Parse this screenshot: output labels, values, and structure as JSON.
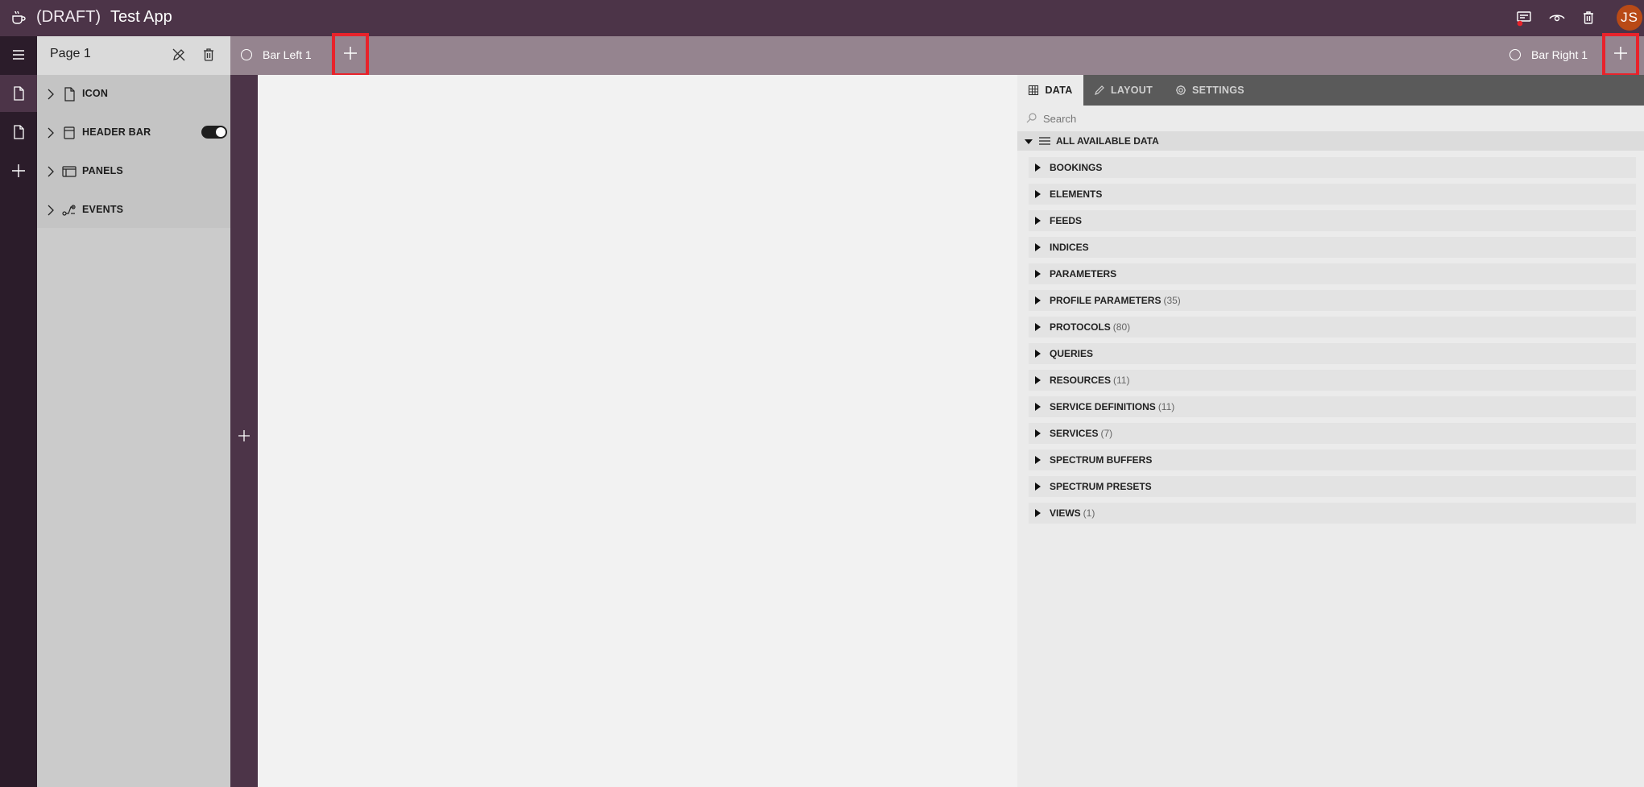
{
  "header": {
    "draft_label": "(DRAFT)",
    "app_title": "Test App",
    "avatar_initials": "JS",
    "icons": [
      "coffee-app-icon",
      "publish-icon",
      "preview-eye-icon",
      "delete-trash-icon"
    ]
  },
  "rail": {
    "icons": [
      "hamburger-menu-icon",
      "page-icon",
      "page-icon",
      "add-icon"
    ]
  },
  "page_tree": {
    "page_name": "Page 1",
    "items": [
      {
        "label": "ICON",
        "icon": "file-icon"
      },
      {
        "label": "HEADER BAR",
        "icon": "header-bar-icon",
        "toggle_on": true
      },
      {
        "label": "PANELS",
        "icon": "panels-icon"
      },
      {
        "label": "EVENTS",
        "icon": "events-icon"
      }
    ]
  },
  "bars": {
    "left_label": "Bar Left 1",
    "right_label": "Bar Right 1"
  },
  "right_panel": {
    "tabs": [
      {
        "label": "DATA",
        "active": true
      },
      {
        "label": "LAYOUT",
        "active": false
      },
      {
        "label": "SETTINGS",
        "active": false
      }
    ],
    "search_placeholder": "Search",
    "root_label": "ALL AVAILABLE DATA",
    "items": [
      {
        "label": "BOOKINGS",
        "count": ""
      },
      {
        "label": "ELEMENTS",
        "count": ""
      },
      {
        "label": "FEEDS",
        "count": ""
      },
      {
        "label": "INDICES",
        "count": ""
      },
      {
        "label": "PARAMETERS",
        "count": ""
      },
      {
        "label": "PROFILE PARAMETERS",
        "count": "(35)"
      },
      {
        "label": "PROTOCOLS",
        "count": "(80)"
      },
      {
        "label": "QUERIES",
        "count": ""
      },
      {
        "label": "RESOURCES",
        "count": "(11)"
      },
      {
        "label": "SERVICE DEFINITIONS",
        "count": "(11)"
      },
      {
        "label": "SERVICES",
        "count": "(7)"
      },
      {
        "label": "SPECTRUM BUFFERS",
        "count": ""
      },
      {
        "label": "SPECTRUM PRESETS",
        "count": ""
      },
      {
        "label": "VIEWS",
        "count": "(1)"
      }
    ]
  },
  "colors": {
    "topbar": "#4c3448",
    "rail": "#2b1c2a",
    "bar_strip": "#95848f",
    "highlight": "#e8232b",
    "avatar": "#b94a16"
  }
}
